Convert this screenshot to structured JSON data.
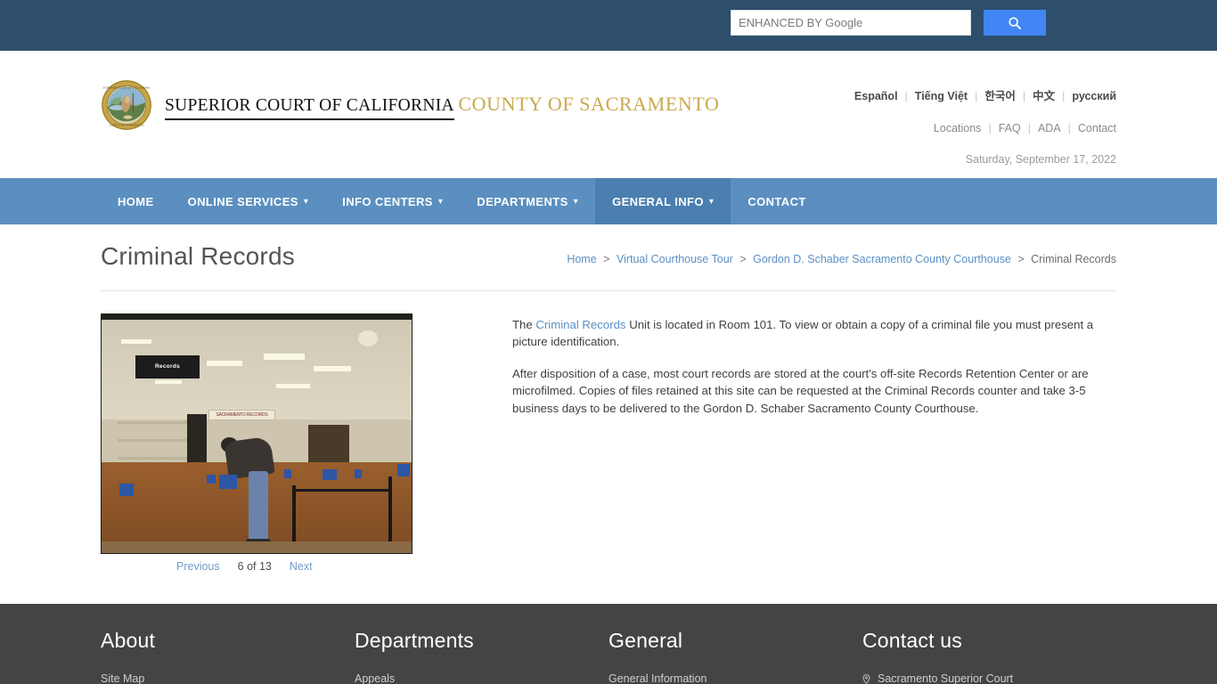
{
  "topbar": {
    "search": {
      "placeholder": "ENHANCED BY Google",
      "value": "",
      "button_icon": "search-icon",
      "button_color": "#4285f4"
    }
  },
  "header": {
    "logo": {
      "icon": "california-state-seal-icon",
      "line1": "SUPERIOR COURT OF CALIFORNIA",
      "line2": "COUNTY OF SACRAMENTO",
      "line2_color": "#c9a94f"
    },
    "languages": [
      {
        "label": "Español"
      },
      {
        "label": "Tiếng Việt"
      },
      {
        "label": "한국어"
      },
      {
        "label": "中文"
      },
      {
        "label": "русский"
      }
    ],
    "utility_links": [
      {
        "label": "Locations"
      },
      {
        "label": "FAQ"
      },
      {
        "label": "ADA"
      },
      {
        "label": "Contact"
      }
    ],
    "date": "Saturday, September 17, 2022"
  },
  "nav": {
    "bg_color": "#5b8fc0",
    "active_color": "#4a7fb0",
    "items": [
      {
        "label": "HOME",
        "has_caret": false,
        "active": false
      },
      {
        "label": "ONLINE SERVICES",
        "has_caret": true,
        "active": false
      },
      {
        "label": "INFO CENTERS",
        "has_caret": true,
        "active": false
      },
      {
        "label": "DEPARTMENTS",
        "has_caret": true,
        "active": false
      },
      {
        "label": "GENERAL INFO",
        "has_caret": true,
        "active": true
      },
      {
        "label": "CONTACT",
        "has_caret": false,
        "active": false
      }
    ]
  },
  "main": {
    "page_title": "Criminal Records",
    "breadcrumb": [
      {
        "label": "Home",
        "link": true
      },
      {
        "label": "Virtual Courthouse Tour",
        "link": true
      },
      {
        "label": "Gordon D. Schaber Sacramento County Courthouse",
        "link": true
      },
      {
        "label": "Criminal Records",
        "link": false
      }
    ],
    "breadcrumb_separator": ">",
    "gallery": {
      "image_alt": "Criminal Records counter at the courthouse",
      "image_sign_text": "Records",
      "image_banner_text": "SACRAMENTO RECORDS",
      "previous_label": "Previous",
      "next_label": "Next",
      "counter": "6 of 13"
    },
    "paragraphs": [
      {
        "parts": [
          {
            "text": "The ",
            "link": false
          },
          {
            "text": "Criminal Records",
            "link": true
          },
          {
            "text": " Unit is located in Room 101. To view or obtain a copy of a criminal file you must present a picture identification.",
            "link": false
          }
        ]
      },
      {
        "parts": [
          {
            "text": "After disposition of a case, most court records are stored at the court's off-site Records Retention Center or are microfilmed. Copies of files retained at this site can be requested at the Criminal Records counter and take 3-5 business days to be delivered to the Gordon D. Schaber Sacramento County Courthouse.",
            "link": false
          }
        ]
      }
    ]
  },
  "footer": {
    "bg_color": "#444444",
    "columns": [
      {
        "title": "About",
        "links": [
          {
            "label": "Site Map"
          }
        ]
      },
      {
        "title": "Departments",
        "links": [
          {
            "label": "Appeals"
          }
        ]
      },
      {
        "title": "General",
        "links": [
          {
            "label": "General Information"
          }
        ]
      },
      {
        "title": "Contact us",
        "links": [
          {
            "label": "Sacramento Superior Court",
            "icon": "location-pin-icon"
          }
        ]
      }
    ]
  }
}
